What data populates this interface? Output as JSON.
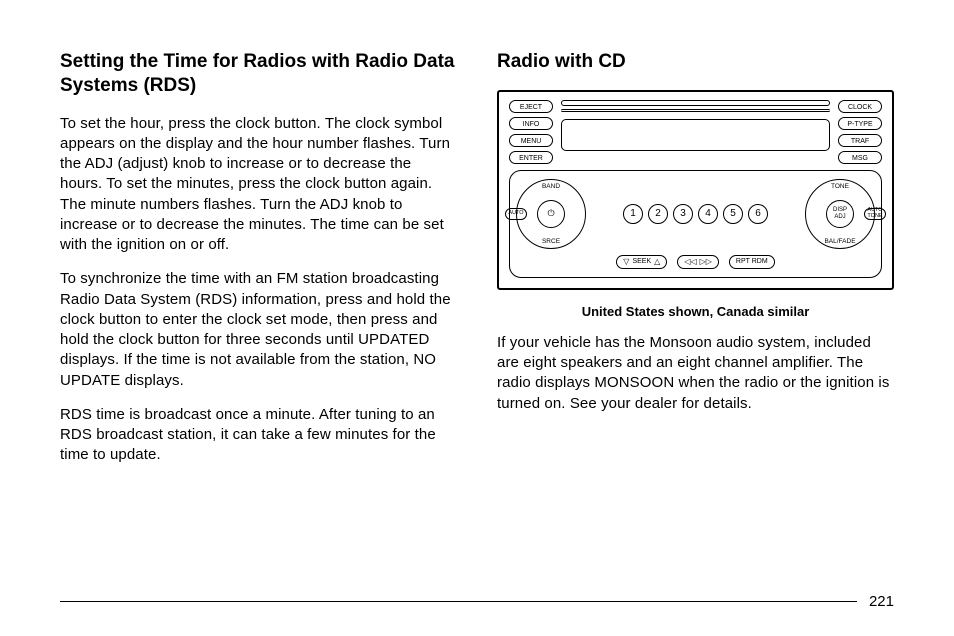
{
  "left": {
    "heading": "Setting the Time for Radios with Radio Data Systems (RDS)",
    "p1": "To set the hour, press the clock button. The clock symbol appears on the display and the hour number flashes. Turn the ADJ (adjust) knob to increase or to decrease the hours. To set the minutes, press the clock button again. The minute numbers flashes. Turn the ADJ knob to increase or to decrease the minutes. The time can be set with the ignition on or off.",
    "p2": "To synchronize the time with an FM station broadcasting Radio Data System (RDS) information, press and hold the clock button to enter the clock set mode, then press and hold the clock button for three seconds until UPDATED displays. If the time is not available from the station, NO UPDATE displays.",
    "p3": "RDS time is broadcast once a minute. After tuning to an RDS broadcast station, it can take a few minutes for the time to update."
  },
  "right": {
    "heading": "Radio with CD",
    "caption": "United States shown, Canada similar",
    "p1": "If your vehicle has the Monsoon audio system, included are eight speakers and an eight channel amplifier. The radio displays MONSOON when the radio or the ignition is turned on. See your dealer for details."
  },
  "radio": {
    "left_buttons": [
      "EJECT",
      "INFO",
      "MENU",
      "ENTER"
    ],
    "right_buttons": [
      "CLOCK",
      "P-TYPE",
      "TRAF",
      "MSG"
    ],
    "knob_left": {
      "top": "BAND",
      "bottom": "SRCE",
      "side": "AUTO"
    },
    "knob_right": {
      "top": "TONE",
      "bottom": "BAL/FADE",
      "center": "DISP\nADJ",
      "side": "AUTO\nTONE"
    },
    "presets": [
      "1",
      "2",
      "3",
      "4",
      "5",
      "6"
    ],
    "controls": {
      "seek": "SEEK",
      "rpt_rdm": "RPT   RDM"
    }
  },
  "page": "221"
}
